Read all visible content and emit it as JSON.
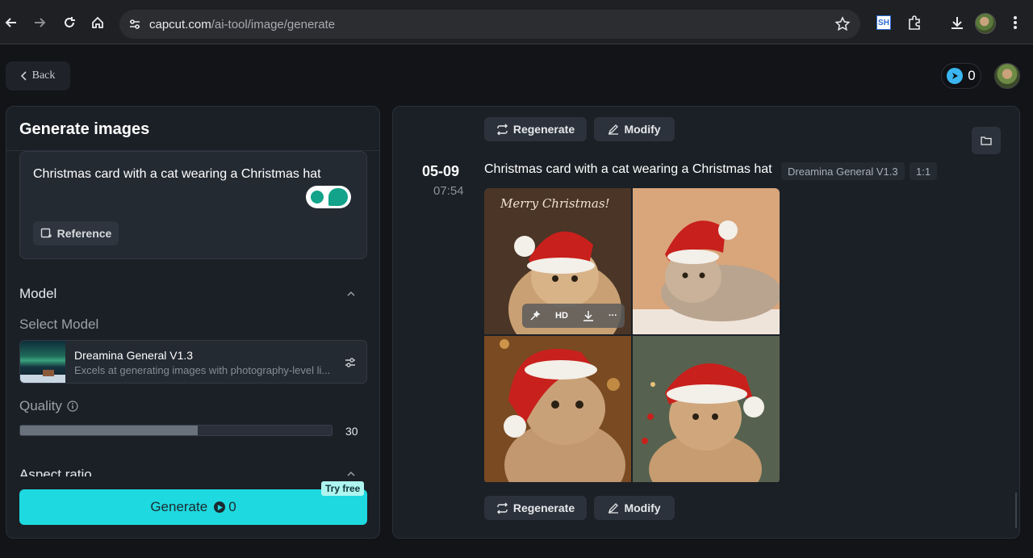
{
  "browser": {
    "url_host": "capcut.com",
    "url_path": "/ai-tool/image/generate",
    "ext_sh": "SH"
  },
  "header": {
    "back_label": "Back",
    "credits": "0"
  },
  "left_panel": {
    "title": "Generate images",
    "prompt": "Christmas card with a cat wearing a Christmas hat",
    "reference_label": "Reference",
    "model_section": "Model",
    "select_model": "Select Model",
    "model_name": "Dreamina General V1.3",
    "model_desc": "Excels at generating images with photography-level li...",
    "quality_label": "Quality",
    "quality_value": "30",
    "quality_fraction": 0.57,
    "aspect_label": "Aspect ratio",
    "generate_label": "Generate",
    "generate_cost": "0",
    "try_free": "Try free"
  },
  "right_panel": {
    "regenerate_label": "Regenerate",
    "modify_label": "Modify",
    "date": "05-09",
    "time": "07:54",
    "prompt": "Christmas card with a cat wearing a Christmas hat",
    "model_tag": "Dreamina General V1.3",
    "ratio_tag": "1:1",
    "card_text": "Merry Christmas!",
    "hd_label": "HD",
    "more_label": "···"
  }
}
